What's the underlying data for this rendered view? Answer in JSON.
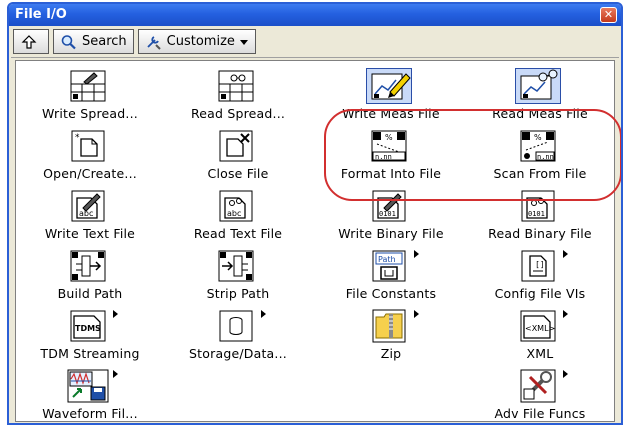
{
  "window": {
    "title": "File I/O"
  },
  "toolbar": {
    "up_label": "",
    "search_label": "Search",
    "customize_label": "Customize"
  },
  "palette": {
    "rows": [
      [
        {
          "label": "Write Spread...",
          "icon": "spreadsheet-write-icon"
        },
        {
          "label": "Read Spread...",
          "icon": "spreadsheet-read-icon"
        },
        {
          "label": "Write Meas File",
          "icon": "write-meas-file-icon"
        },
        {
          "label": "Read Meas File",
          "icon": "read-meas-file-icon"
        }
      ],
      [
        {
          "label": "Open/Create...",
          "icon": "open-create-file-icon"
        },
        {
          "label": "Close File",
          "icon": "close-file-icon"
        },
        {
          "label": "Format Into File",
          "icon": "format-into-file-icon"
        },
        {
          "label": "Scan From File",
          "icon": "scan-from-file-icon"
        }
      ],
      [
        {
          "label": "Write Text File",
          "icon": "write-text-file-icon"
        },
        {
          "label": "Read Text File",
          "icon": "read-text-file-icon"
        },
        {
          "label": "Write Binary File",
          "icon": "write-binary-file-icon"
        },
        {
          "label": "Read Binary File",
          "icon": "read-binary-file-icon"
        }
      ],
      [
        {
          "label": "Build Path",
          "icon": "build-path-icon"
        },
        {
          "label": "Strip Path",
          "icon": "strip-path-icon"
        },
        {
          "label": "File Constants",
          "icon": "file-constants-icon"
        },
        {
          "label": "Config File VIs",
          "icon": "config-file-icon"
        }
      ],
      [
        {
          "label": "TDM Streaming",
          "icon": "tdms-icon"
        },
        {
          "label": "Storage/Data...",
          "icon": "storage-icon"
        },
        {
          "label": "Zip",
          "icon": "zip-folder-icon"
        },
        {
          "label": "XML",
          "icon": "xml-icon"
        }
      ],
      [
        {
          "label": "Waveform Fil...",
          "icon": "waveform-file-icon"
        },
        {
          "label": "",
          "icon": ""
        },
        {
          "label": "",
          "icon": ""
        },
        {
          "label": "Adv File Funcs",
          "icon": "adv-file-funcs-icon"
        }
      ]
    ],
    "icon_text": {
      "tdms": "TDMS",
      "xml": "<XML>",
      "path": "Path",
      "abc": "abc",
      "bin": "0101",
      "nnn": "n.nn"
    }
  },
  "colors": {
    "titlebar": "#2460e0",
    "highlight": "#d22f2f",
    "selected_icon_bg": "#c9daf8"
  }
}
